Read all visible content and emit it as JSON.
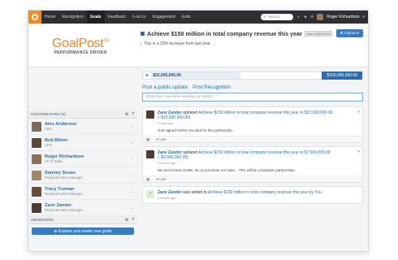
{
  "nav": {
    "items": [
      "Home",
      "Recognition",
      "Goals",
      "Feedback",
      "1-on-1s",
      "Engagement",
      "Exits"
    ],
    "active": "Goals",
    "search_placeholder": "Search",
    "user_name": "Roger Richardson"
  },
  "brand": {
    "name": "GoalPost",
    "tm": "TM",
    "tagline": "PERFORMANCE DRIVEN"
  },
  "goal": {
    "title": "Achieve $150 million in total company revenue this year",
    "due": "Due 05/09/2016",
    "actions_label": "Actions",
    "subtitle": "This is a 20% increase from last year.",
    "current": "$22,000,000.00",
    "target": "$150,000,000.00",
    "progress": 0.147
  },
  "contributors": {
    "header": "CONTRIBUTORS (6)",
    "list": [
      {
        "name": "Alex Anderson",
        "role": "CEO"
      },
      {
        "name": "Bob Bitner",
        "role": "CFO"
      },
      {
        "name": "Roger Richardson",
        "role": "VP of Sales"
      },
      {
        "name": "Sammy Sosas",
        "role": "Regional Sales Manager"
      },
      {
        "name": "Tracy Truman",
        "role": "Regional Sales Manager"
      },
      {
        "name": "Zane Zander",
        "role": "Regional Sales Manager"
      }
    ]
  },
  "observers": {
    "header": "OBSERVERS"
  },
  "explore_label": "Explore and create new goals",
  "tabs": {
    "post_update": "Post a public update",
    "post_recognition": "Post Recognition"
  },
  "post_placeholder": "What have you been working on lately?",
  "feed": [
    {
      "who": "Zane Zander",
      "action": "updated",
      "goal": "Achieve $150 million in total company revenue this year",
      "rest": "to $22,000,000.00",
      "delta": "(↑$15,000,000.00)",
      "time": "3 days ago",
      "comment": "Just signed SONY! Excited for the partnership.",
      "like": "Like"
    },
    {
      "who": "Zane Zander",
      "action": "updated",
      "goal": "Achieve $150 million in total company revenue this year",
      "rest": "to $7,000,000.00",
      "delta": "(↑$2,000,000.00)",
      "time": "2 weeks ago",
      "comment": "We just closed ACME, Inc to purchase our suite... This will be a fantastic partnership!",
      "like": "Like"
    },
    {
      "who": "Zane Zander",
      "action": "was added to",
      "goal": "Achieve $150 million in total company revenue this year",
      "rest": "by You",
      "time": "3 weeks ago"
    }
  ]
}
